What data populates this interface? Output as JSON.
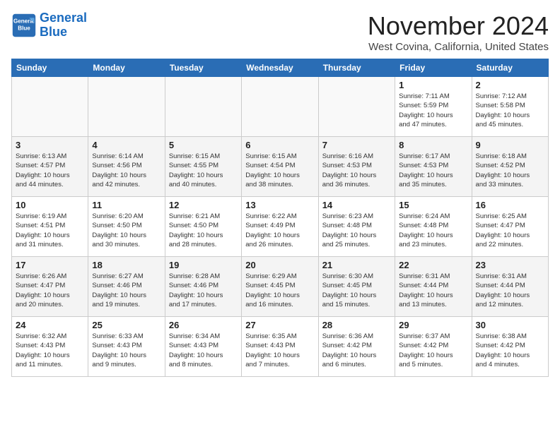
{
  "header": {
    "logo_line1": "General",
    "logo_line2": "Blue",
    "month_title": "November 2024",
    "location": "West Covina, California, United States"
  },
  "weekdays": [
    "Sunday",
    "Monday",
    "Tuesday",
    "Wednesday",
    "Thursday",
    "Friday",
    "Saturday"
  ],
  "weeks": [
    [
      {
        "day": "",
        "detail": ""
      },
      {
        "day": "",
        "detail": ""
      },
      {
        "day": "",
        "detail": ""
      },
      {
        "day": "",
        "detail": ""
      },
      {
        "day": "",
        "detail": ""
      },
      {
        "day": "1",
        "detail": "Sunrise: 7:11 AM\nSunset: 5:59 PM\nDaylight: 10 hours\nand 47 minutes."
      },
      {
        "day": "2",
        "detail": "Sunrise: 7:12 AM\nSunset: 5:58 PM\nDaylight: 10 hours\nand 45 minutes."
      }
    ],
    [
      {
        "day": "3",
        "detail": "Sunrise: 6:13 AM\nSunset: 4:57 PM\nDaylight: 10 hours\nand 44 minutes."
      },
      {
        "day": "4",
        "detail": "Sunrise: 6:14 AM\nSunset: 4:56 PM\nDaylight: 10 hours\nand 42 minutes."
      },
      {
        "day": "5",
        "detail": "Sunrise: 6:15 AM\nSunset: 4:55 PM\nDaylight: 10 hours\nand 40 minutes."
      },
      {
        "day": "6",
        "detail": "Sunrise: 6:15 AM\nSunset: 4:54 PM\nDaylight: 10 hours\nand 38 minutes."
      },
      {
        "day": "7",
        "detail": "Sunrise: 6:16 AM\nSunset: 4:53 PM\nDaylight: 10 hours\nand 36 minutes."
      },
      {
        "day": "8",
        "detail": "Sunrise: 6:17 AM\nSunset: 4:53 PM\nDaylight: 10 hours\nand 35 minutes."
      },
      {
        "day": "9",
        "detail": "Sunrise: 6:18 AM\nSunset: 4:52 PM\nDaylight: 10 hours\nand 33 minutes."
      }
    ],
    [
      {
        "day": "10",
        "detail": "Sunrise: 6:19 AM\nSunset: 4:51 PM\nDaylight: 10 hours\nand 31 minutes."
      },
      {
        "day": "11",
        "detail": "Sunrise: 6:20 AM\nSunset: 4:50 PM\nDaylight: 10 hours\nand 30 minutes."
      },
      {
        "day": "12",
        "detail": "Sunrise: 6:21 AM\nSunset: 4:50 PM\nDaylight: 10 hours\nand 28 minutes."
      },
      {
        "day": "13",
        "detail": "Sunrise: 6:22 AM\nSunset: 4:49 PM\nDaylight: 10 hours\nand 26 minutes."
      },
      {
        "day": "14",
        "detail": "Sunrise: 6:23 AM\nSunset: 4:48 PM\nDaylight: 10 hours\nand 25 minutes."
      },
      {
        "day": "15",
        "detail": "Sunrise: 6:24 AM\nSunset: 4:48 PM\nDaylight: 10 hours\nand 23 minutes."
      },
      {
        "day": "16",
        "detail": "Sunrise: 6:25 AM\nSunset: 4:47 PM\nDaylight: 10 hours\nand 22 minutes."
      }
    ],
    [
      {
        "day": "17",
        "detail": "Sunrise: 6:26 AM\nSunset: 4:47 PM\nDaylight: 10 hours\nand 20 minutes."
      },
      {
        "day": "18",
        "detail": "Sunrise: 6:27 AM\nSunset: 4:46 PM\nDaylight: 10 hours\nand 19 minutes."
      },
      {
        "day": "19",
        "detail": "Sunrise: 6:28 AM\nSunset: 4:46 PM\nDaylight: 10 hours\nand 17 minutes."
      },
      {
        "day": "20",
        "detail": "Sunrise: 6:29 AM\nSunset: 4:45 PM\nDaylight: 10 hours\nand 16 minutes."
      },
      {
        "day": "21",
        "detail": "Sunrise: 6:30 AM\nSunset: 4:45 PM\nDaylight: 10 hours\nand 15 minutes."
      },
      {
        "day": "22",
        "detail": "Sunrise: 6:31 AM\nSunset: 4:44 PM\nDaylight: 10 hours\nand 13 minutes."
      },
      {
        "day": "23",
        "detail": "Sunrise: 6:31 AM\nSunset: 4:44 PM\nDaylight: 10 hours\nand 12 minutes."
      }
    ],
    [
      {
        "day": "24",
        "detail": "Sunrise: 6:32 AM\nSunset: 4:43 PM\nDaylight: 10 hours\nand 11 minutes."
      },
      {
        "day": "25",
        "detail": "Sunrise: 6:33 AM\nSunset: 4:43 PM\nDaylight: 10 hours\nand 9 minutes."
      },
      {
        "day": "26",
        "detail": "Sunrise: 6:34 AM\nSunset: 4:43 PM\nDaylight: 10 hours\nand 8 minutes."
      },
      {
        "day": "27",
        "detail": "Sunrise: 6:35 AM\nSunset: 4:43 PM\nDaylight: 10 hours\nand 7 minutes."
      },
      {
        "day": "28",
        "detail": "Sunrise: 6:36 AM\nSunset: 4:42 PM\nDaylight: 10 hours\nand 6 minutes."
      },
      {
        "day": "29",
        "detail": "Sunrise: 6:37 AM\nSunset: 4:42 PM\nDaylight: 10 hours\nand 5 minutes."
      },
      {
        "day": "30",
        "detail": "Sunrise: 6:38 AM\nSunset: 4:42 PM\nDaylight: 10 hours\nand 4 minutes."
      }
    ]
  ]
}
